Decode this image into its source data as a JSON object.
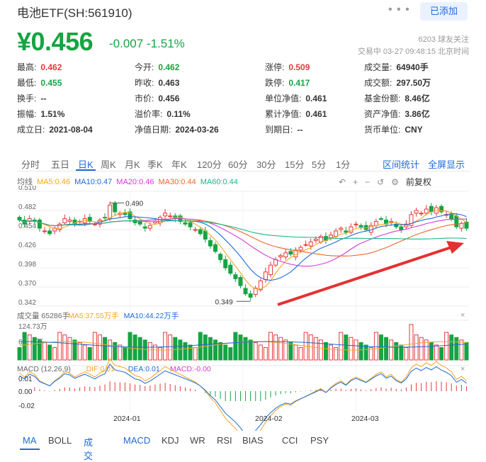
{
  "header": {
    "title": "电池ETF(SH:561910)",
    "more_label": "• • •",
    "follow_label": "已添加"
  },
  "quote": {
    "price": "¥0.456",
    "change": "-0.007 -1.51%",
    "followers": "6203  球友关注",
    "status_time": "交易中  03-27  09:48:15  北京时间"
  },
  "stats": [
    {
      "label": "最高:",
      "value": "0.462",
      "tone": "up"
    },
    {
      "label": "今开:",
      "value": "0.462",
      "tone": "down"
    },
    {
      "label": "涨停:",
      "value": "0.509",
      "tone": "up"
    },
    {
      "label": "成交量:",
      "value": "64940手",
      "tone": "flat"
    },
    {
      "label": "最低:",
      "value": "0.455",
      "tone": "down"
    },
    {
      "label": "昨收:",
      "value": "0.463",
      "tone": "flat"
    },
    {
      "label": "跌停:",
      "value": "0.417",
      "tone": "down"
    },
    {
      "label": "成交额:",
      "value": "297.50万",
      "tone": "flat"
    },
    {
      "label": "换手:",
      "value": "--",
      "tone": "flat"
    },
    {
      "label": "市价:",
      "value": "0.456",
      "tone": "flat"
    },
    {
      "label": "单位净值:",
      "value": "0.461",
      "tone": "flat"
    },
    {
      "label": "基金份额:",
      "value": "8.46亿",
      "tone": "flat"
    },
    {
      "label": "振幅:",
      "value": "1.51%",
      "tone": "flat"
    },
    {
      "label": "溢价率:",
      "value": "0.11%",
      "tone": "flat"
    },
    {
      "label": "累计净值:",
      "value": "0.461",
      "tone": "flat"
    },
    {
      "label": "资产净值:",
      "value": "3.86亿",
      "tone": "flat"
    },
    {
      "label": "成立日:",
      "value": "2021-08-04",
      "tone": "flat"
    },
    {
      "label": "净值日期:",
      "value": "2024-03-26",
      "tone": "flat"
    },
    {
      "label": "到期日:",
      "value": "--",
      "tone": "flat"
    },
    {
      "label": "货币单位:",
      "value": "CNY",
      "tone": "flat"
    }
  ],
  "period_tabs": [
    "分时",
    "五日",
    "日K",
    "周K",
    "月K",
    "季K",
    "年K",
    "120分",
    "60分",
    "30分",
    "15分",
    "5分",
    "1分"
  ],
  "period_active": "日K",
  "range_stats_label": "区间统计",
  "fullscreen_label": "全屏显示",
  "rehab_label": "前复权",
  "ma_legend": [
    {
      "text": "均线",
      "color": "#666666"
    },
    {
      "text": "MA5:0.46",
      "color": "#f5a623"
    },
    {
      "text": "MA10:0.47",
      "color": "#1e6ad8"
    },
    {
      "text": "MA20:0.46",
      "color": "#d63ad6"
    },
    {
      "text": "MA30:0.44",
      "color": "#f0662c"
    },
    {
      "text": "MA60:0.44",
      "color": "#1fb58a"
    }
  ],
  "vol_legend": [
    {
      "text": "成交量 65286手",
      "color": "#666666"
    },
    {
      "text": "MA5:37.55万手",
      "color": "#f5a623"
    },
    {
      "text": "MA10:44.22万手",
      "color": "#1e6ad8"
    }
  ],
  "macd_legend": [
    {
      "text": "MACD (12,26,9)",
      "color": "#666666"
    },
    {
      "text": "DIF:0.01",
      "color": "#f5a623"
    },
    {
      "text": "DEA:0.01",
      "color": "#1e6ad8"
    },
    {
      "text": "MACD:-0.00",
      "color": "#d63ad6"
    }
  ],
  "price_axis": [
    "0.510",
    "0.482",
    "0.454",
    "0.426",
    "0.398",
    "0.370",
    "0.342"
  ],
  "vol_axis": [
    "124.73万",
    "62.36万"
  ],
  "macd_axis": [
    "0.01",
    "0.00",
    "-0.02"
  ],
  "date_axis": [
    "2024-01",
    "2024-02",
    "2024-03"
  ],
  "annotations": {
    "high": "0.490",
    "low": "0.349"
  },
  "indicator_tabs": [
    "MA",
    "BOLL",
    "成交量",
    "MACD",
    "KDJ",
    "WR",
    "RSI",
    "BIAS",
    "CCI",
    "PSY"
  ],
  "indicator_active": [
    "MA",
    "成交量",
    "MACD"
  ],
  "colors": {
    "up": "#e6393b",
    "down": "#15a443",
    "accent": "#1e6ad8"
  },
  "chart_data": {
    "type": "candlestick",
    "title": "",
    "x_range": [
      "2023-12-01",
      "2024-03-27"
    ],
    "ylim": [
      0.342,
      0.51
    ],
    "closes": [
      0.468,
      0.462,
      0.47,
      0.466,
      0.456,
      0.452,
      0.448,
      0.456,
      0.462,
      0.47,
      0.468,
      0.462,
      0.466,
      0.47,
      0.466,
      0.462,
      0.468,
      0.472,
      0.49,
      0.48,
      0.478,
      0.476,
      0.47,
      0.464,
      0.462,
      0.456,
      0.46,
      0.466,
      0.472,
      0.478,
      0.474,
      0.47,
      0.466,
      0.462,
      0.458,
      0.454,
      0.448,
      0.44,
      0.43,
      0.422,
      0.41,
      0.398,
      0.39,
      0.382,
      0.372,
      0.36,
      0.355,
      0.368,
      0.379,
      0.392,
      0.402,
      0.41,
      0.416,
      0.42,
      0.418,
      0.424,
      0.428,
      0.432,
      0.436,
      0.44,
      0.444,
      0.438,
      0.446,
      0.452,
      0.456,
      0.45,
      0.458,
      0.462,
      0.458,
      0.454,
      0.46,
      0.466,
      0.47,
      0.462,
      0.466,
      0.458,
      0.454,
      0.462,
      0.476,
      0.482,
      0.478,
      0.484,
      0.48,
      0.486,
      0.48,
      0.476,
      0.47,
      0.458,
      0.463,
      0.456
    ],
    "volume_max": "124.73万"
  }
}
